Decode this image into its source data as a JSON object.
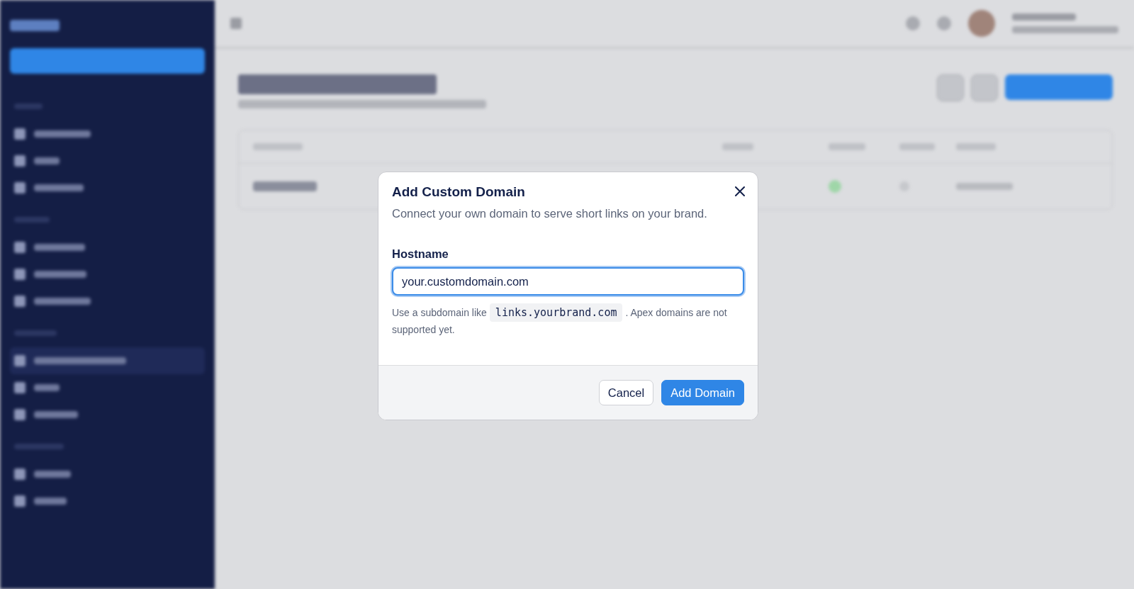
{
  "sidebar": {
    "items": [
      {
        "selected": false
      },
      {
        "selected": false
      },
      {
        "selected": false
      },
      {
        "selected": false
      },
      {
        "selected": false
      },
      {
        "selected": false
      },
      {
        "selected": true
      },
      {
        "selected": false
      },
      {
        "selected": false
      },
      {
        "selected": false
      },
      {
        "selected": false
      }
    ]
  },
  "dialog": {
    "title": "Add Custom Domain",
    "description": "Connect your own domain to serve short links on your brand.",
    "field_label": "Hostname",
    "field_value": "your.customdomain.com",
    "hint_before": "Use a subdomain like",
    "hint_code": "links.yourbrand.com",
    "hint_after": ". Apex domains are not supported yet.",
    "buttons": [
      {
        "label": "Cancel",
        "kind": "secondary"
      },
      {
        "label": "Add Domain",
        "kind": "primary"
      }
    ]
  }
}
